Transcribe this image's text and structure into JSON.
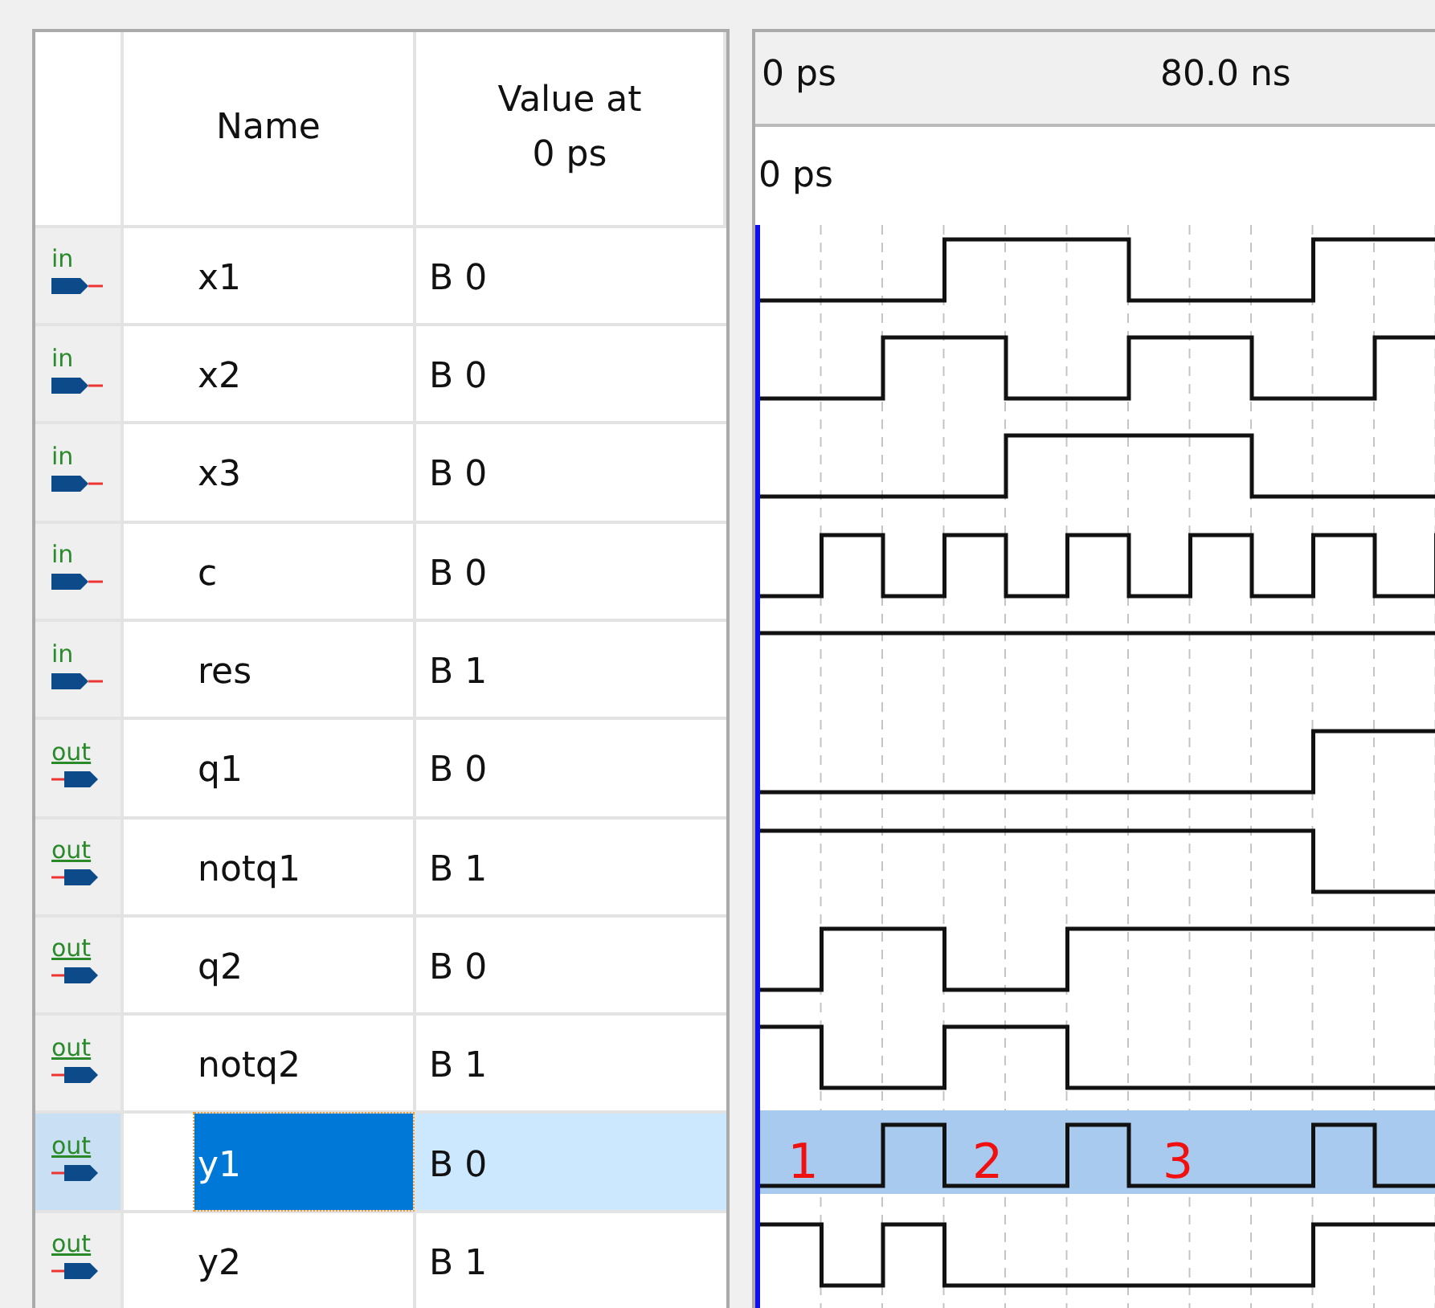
{
  "columns": {
    "name": "Name",
    "value": "Value at\n0 ps"
  },
  "ruler": {
    "start": "0 ps",
    "mark": "80.0 ns"
  },
  "cursor": {
    "time": "0 ps"
  },
  "signals": [
    {
      "kind": "input",
      "pin_label": "in",
      "name": "x1",
      "value": "B 0",
      "selected": false
    },
    {
      "kind": "input",
      "pin_label": "in",
      "name": "x2",
      "value": "B 0",
      "selected": false
    },
    {
      "kind": "input",
      "pin_label": "in",
      "name": "x3",
      "value": "B 0",
      "selected": false
    },
    {
      "kind": "input",
      "pin_label": "in",
      "name": "c",
      "value": "B 0",
      "selected": false
    },
    {
      "kind": "input",
      "pin_label": "in",
      "name": "res",
      "value": "B 1",
      "selected": false
    },
    {
      "kind": "output",
      "pin_label": "out",
      "name": "q1",
      "value": "B 0",
      "selected": false
    },
    {
      "kind": "output",
      "pin_label": "out",
      "name": "notq1",
      "value": "B 1",
      "selected": false
    },
    {
      "kind": "output",
      "pin_label": "out",
      "name": "q2",
      "value": "B 0",
      "selected": false
    },
    {
      "kind": "output",
      "pin_label": "out",
      "name": "notq2",
      "value": "B 1",
      "selected": false
    },
    {
      "kind": "output",
      "pin_label": "out",
      "name": "y1",
      "value": "B 0",
      "selected": true,
      "annotations": [
        "1",
        "2",
        "3"
      ]
    },
    {
      "kind": "output",
      "pin_label": "out",
      "name": "y2",
      "value": "B 1",
      "selected": false
    }
  ]
}
